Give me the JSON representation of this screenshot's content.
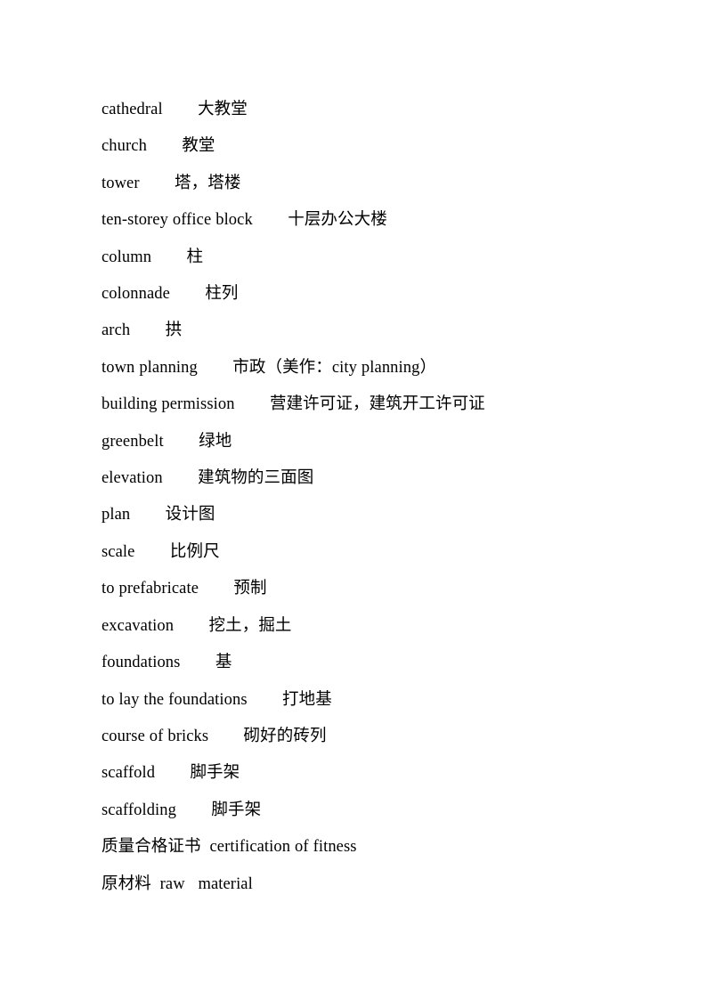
{
  "document": {
    "page_background": "#ffffff",
    "text_color": "#000000",
    "topic": "architecture-and-construction-glossary",
    "line_count": 22,
    "lines": [
      {
        "id": "cathedral",
        "text": "cathedral        大教堂"
      },
      {
        "id": "church",
        "text": "church        教堂"
      },
      {
        "id": "tower",
        "text": "tower        塔，塔楼"
      },
      {
        "id": "ten-storey-office-block",
        "text": "ten-storey office block        十层办公大楼"
      },
      {
        "id": "column",
        "text": "column        柱"
      },
      {
        "id": "colonnade",
        "text": "colonnade        柱列"
      },
      {
        "id": "arch",
        "text": "arch        拱"
      },
      {
        "id": "town-planning",
        "text": "town planning        市政（美作：city planning）"
      },
      {
        "id": "building-permission",
        "text": "building permission        营建许可证，建筑开工许可证"
      },
      {
        "id": "greenbelt",
        "text": "greenbelt        绿地"
      },
      {
        "id": "elevation",
        "text": "elevation        建筑物的三面图"
      },
      {
        "id": "plan",
        "text": "plan        设计图"
      },
      {
        "id": "scale",
        "text": "scale        比例尺"
      },
      {
        "id": "to-prefabricate",
        "text": "to prefabricate        预制"
      },
      {
        "id": "excavation",
        "text": "excavation        挖土，掘土"
      },
      {
        "id": "foundations",
        "text": "foundations        基"
      },
      {
        "id": "to-lay-the-foundations",
        "text": "to lay the foundations        打地基"
      },
      {
        "id": "course-of-bricks",
        "text": "course of bricks        砌好的砖列"
      },
      {
        "id": "scaffold",
        "text": "scaffold        脚手架"
      },
      {
        "id": "scaffolding",
        "text": "scaffolding        脚手架"
      },
      {
        "id": "certification-of-fitness",
        "text": "质量合格证书  certification of fitness"
      },
      {
        "id": "raw-material",
        "text": "原材料  raw   material"
      }
    ]
  }
}
